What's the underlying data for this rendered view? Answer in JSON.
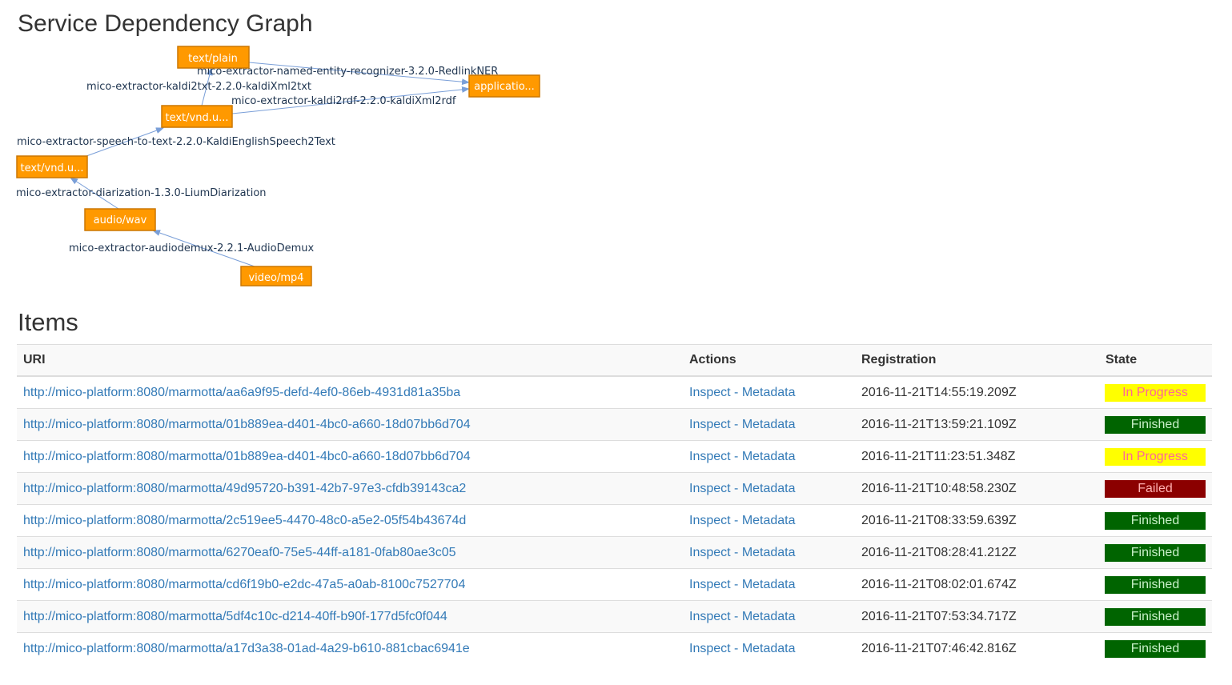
{
  "graph": {
    "title": "Service Dependency Graph",
    "nodes": [
      {
        "id": "text_plain",
        "label": "text/plain"
      },
      {
        "id": "application",
        "label": "applicatio..."
      },
      {
        "id": "text_vnd_2",
        "label": "text/vnd.u..."
      },
      {
        "id": "text_vnd_1",
        "label": "text/vnd.u..."
      },
      {
        "id": "audio_wav",
        "label": "audio/wav"
      },
      {
        "id": "video_mp4",
        "label": "video/mp4"
      }
    ],
    "edges": [
      {
        "label": "mico-extractor-named-entity-recognizer-3.2.0-RedlinkNER"
      },
      {
        "label": "mico-extractor-kaldi2txt-2.2.0-kaldiXml2txt"
      },
      {
        "label": "mico-extractor-kaldi2rdf-2.2.0-kaldiXml2rdf"
      },
      {
        "label": "mico-extractor-speech-to-text-2.2.0-KaldiEnglishSpeech2Text"
      },
      {
        "label": "mico-extractor-diarization-1.3.0-LiumDiarization"
      },
      {
        "label": "mico-extractor-audiodemux-2.2.1-AudioDemux"
      }
    ]
  },
  "items": {
    "title": "Items",
    "columns": {
      "uri": "URI",
      "actions": "Actions",
      "registration": "Registration",
      "state": "State"
    },
    "action_labels": {
      "inspect": "Inspect",
      "separator": " - ",
      "metadata": "Metadata"
    },
    "state_colors": {
      "In Progress": {
        "bg": "#ffff00",
        "fg": "#ff6699"
      },
      "Finished": {
        "bg": "#006400",
        "fg": "#c8f0c8"
      },
      "Failed": {
        "bg": "#8b0000",
        "fg": "#ffb0b0"
      }
    },
    "rows": [
      {
        "uri": "http://mico-platform:8080/marmotta/aa6a9f95-defd-4ef0-86eb-4931d81a35ba",
        "registration": "2016-11-21T14:55:19.209Z",
        "state": "In Progress"
      },
      {
        "uri": "http://mico-platform:8080/marmotta/01b889ea-d401-4bc0-a660-18d07bb6d704",
        "registration": "2016-11-21T13:59:21.109Z",
        "state": "Finished"
      },
      {
        "uri": "http://mico-platform:8080/marmotta/01b889ea-d401-4bc0-a660-18d07bb6d704",
        "registration": "2016-11-21T11:23:51.348Z",
        "state": "In Progress"
      },
      {
        "uri": "http://mico-platform:8080/marmotta/49d95720-b391-42b7-97e3-cfdb39143ca2",
        "registration": "2016-11-21T10:48:58.230Z",
        "state": "Failed"
      },
      {
        "uri": "http://mico-platform:8080/marmotta/2c519ee5-4470-48c0-a5e2-05f54b43674d",
        "registration": "2016-11-21T08:33:59.639Z",
        "state": "Finished"
      },
      {
        "uri": "http://mico-platform:8080/marmotta/6270eaf0-75e5-44ff-a181-0fab80ae3c05",
        "registration": "2016-11-21T08:28:41.212Z",
        "state": "Finished"
      },
      {
        "uri": "http://mico-platform:8080/marmotta/cd6f19b0-e2dc-47a5-a0ab-8100c7527704",
        "registration": "2016-11-21T08:02:01.674Z",
        "state": "Finished"
      },
      {
        "uri": "http://mico-platform:8080/marmotta/5df4c10c-d214-40ff-b90f-177d5fc0f044",
        "registration": "2016-11-21T07:53:34.717Z",
        "state": "Finished"
      },
      {
        "uri": "http://mico-platform:8080/marmotta/a17d3a38-01ad-4a29-b610-881cbac6941e",
        "registration": "2016-11-21T07:46:42.816Z",
        "state": "Finished"
      }
    ]
  }
}
